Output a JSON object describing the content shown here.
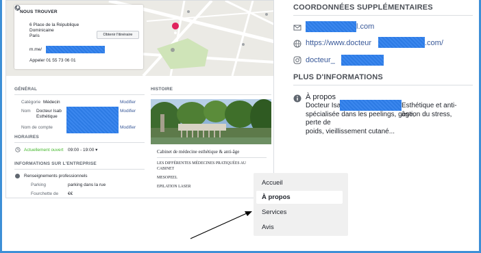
{
  "find_us": {
    "title": "NOUS TROUVER",
    "address_line1": "6 Place de la République",
    "address_line2": "Dominicaine",
    "address_line3": "Paris",
    "route_button": "Obtenir l'itinéraire",
    "messenger_prefix": "m.me/",
    "phone": "Appeler 01 55 73 06 01"
  },
  "general": {
    "heading": "GÉNÉRAL",
    "category_label": "Catégorie",
    "category_value": "Médecin",
    "name_label": "Nom",
    "name_value_line1": "Docteur Isab",
    "name_value_line2": "Esthétique",
    "account_label": "Nom de compte",
    "modify": "Modifier"
  },
  "hours": {
    "heading": "HORAIRES",
    "status": "Actuellement ouvert",
    "range": "09:00 - 19:00 ▾"
  },
  "business_info": {
    "heading": "INFORMATIONS SUR L'ENTREPRISE",
    "pro_info": "Renseignements professionnels",
    "parking_label": "Parking",
    "parking_value": "parking dans la rue",
    "cut_label": "Fourchette de",
    "cut_value": "€€"
  },
  "history": {
    "heading": "HISTOIRE",
    "title": "Cabinet de médecine esthétique & anti-âge",
    "line1": "LES DIFFÉRENTES MÉDECINES PRATIQUÉES AU",
    "line2": "CABINET",
    "line3": "MESOPEEL",
    "line4": "EPILATION LASER"
  },
  "additional": {
    "heading": "COORDONNÉES SUPPLÉMENTAIRES",
    "email_suffix": "l.com",
    "website_prefix": "https://www.docteur",
    "website_suffix": ".com/",
    "instagram_prefix": "docteur_"
  },
  "more_info": {
    "heading": "PLUS D'INFORMATIONS",
    "about_title": "À propos",
    "about_line1_start": "Docteur Isabelle",
    "about_line1_end": "Esthétique et anti-âge,",
    "about_line2": "spécialisée dans les peelings, gestion du stress, perte de",
    "about_line3": "poids, vieillissement cutané..."
  },
  "menu": {
    "items": [
      "Accueil",
      "À propos",
      "Services",
      "Avis"
    ],
    "active": "À propos"
  },
  "colors": {
    "frame": "#3d8fd6",
    "redaction": "#2f80ed",
    "link": "#385898",
    "open": "#42b72a",
    "map_pin": "#e0245e"
  }
}
